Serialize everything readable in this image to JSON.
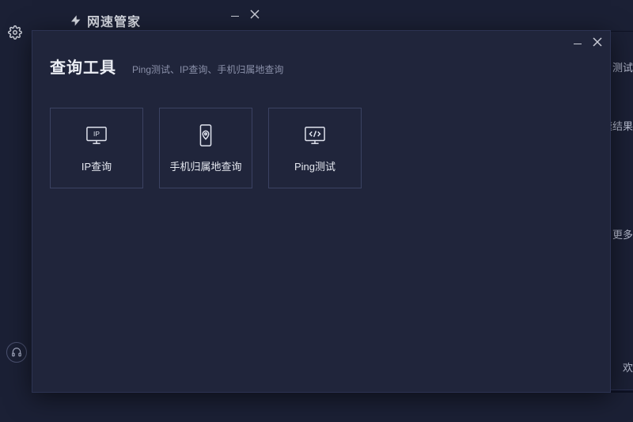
{
  "bgWindow": {
    "appName": "网速管家",
    "sideTexts": {
      "t1": "测试",
      "t2": "速结果",
      "t3": "更多",
      "t4": "欢"
    }
  },
  "modal": {
    "title": "查询工具",
    "subtitle": "Ping测试、IP查询、手机归属地查询",
    "tiles": [
      {
        "id": "ip-query",
        "label": "IP查询",
        "icon": "ip-monitor-icon"
      },
      {
        "id": "phone-location",
        "label": "手机归属地查询",
        "icon": "phone-location-icon"
      },
      {
        "id": "ping-test",
        "label": "Ping测试",
        "icon": "ping-code-icon"
      }
    ]
  }
}
